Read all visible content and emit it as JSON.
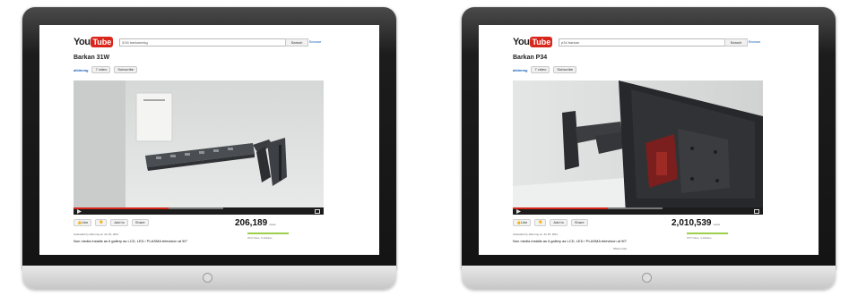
{
  "left_screen": {
    "logo": {
      "you": "You",
      "tube": "Tube"
    },
    "search_query": "3/16 barkanmkg",
    "search_button": "Search",
    "browse_link": "Browse",
    "video_title": "Barkan 31W",
    "channel": "albimmg",
    "videos_count": "7 video",
    "subscribe_label": "Subscribe",
    "action_buttons": [
      "Like",
      "Add to",
      "Share"
    ],
    "views": "206,189",
    "views_suffix": "views",
    "rating_text": "2017 likes, 5 dislikes",
    "uploader": "Uploaded by albimmg on Jul 25, 2011",
    "description": "Non media installs as it gallery as LCD, LED / PLASMA television at 90°",
    "progress": 0.38
  },
  "right_screen": {
    "logo": {
      "you": "You",
      "tube": "Tube"
    },
    "search_query": "p34 barkan",
    "search_button": "Search",
    "browse_link": "Browse",
    "video_title": "Barkan P34",
    "channel": "albimmg",
    "videos_count": "7 video",
    "subscribe_label": "Subscribe",
    "action_buttons": [
      "Like",
      "Add to",
      "Share"
    ],
    "views": "2,010,539",
    "views_suffix": "views",
    "rating_text": "1577 likes, 4 dislikes",
    "uploader": "Uploaded by albimmg on Jul 25, 2011",
    "description": "Non media installs as it gallery as LCD, LED / PLASMA television at 90°",
    "show_more": "Show more",
    "progress": 0.38
  },
  "colors": {
    "youtube_red": "#d8261c",
    "link_blue": "#1c62b9",
    "rating_green": "#9ccf4a"
  },
  "icons": [
    "home-button-icon",
    "play-icon",
    "fullscreen-icon",
    "like-icon",
    "dislike-icon",
    "share-icon"
  ]
}
